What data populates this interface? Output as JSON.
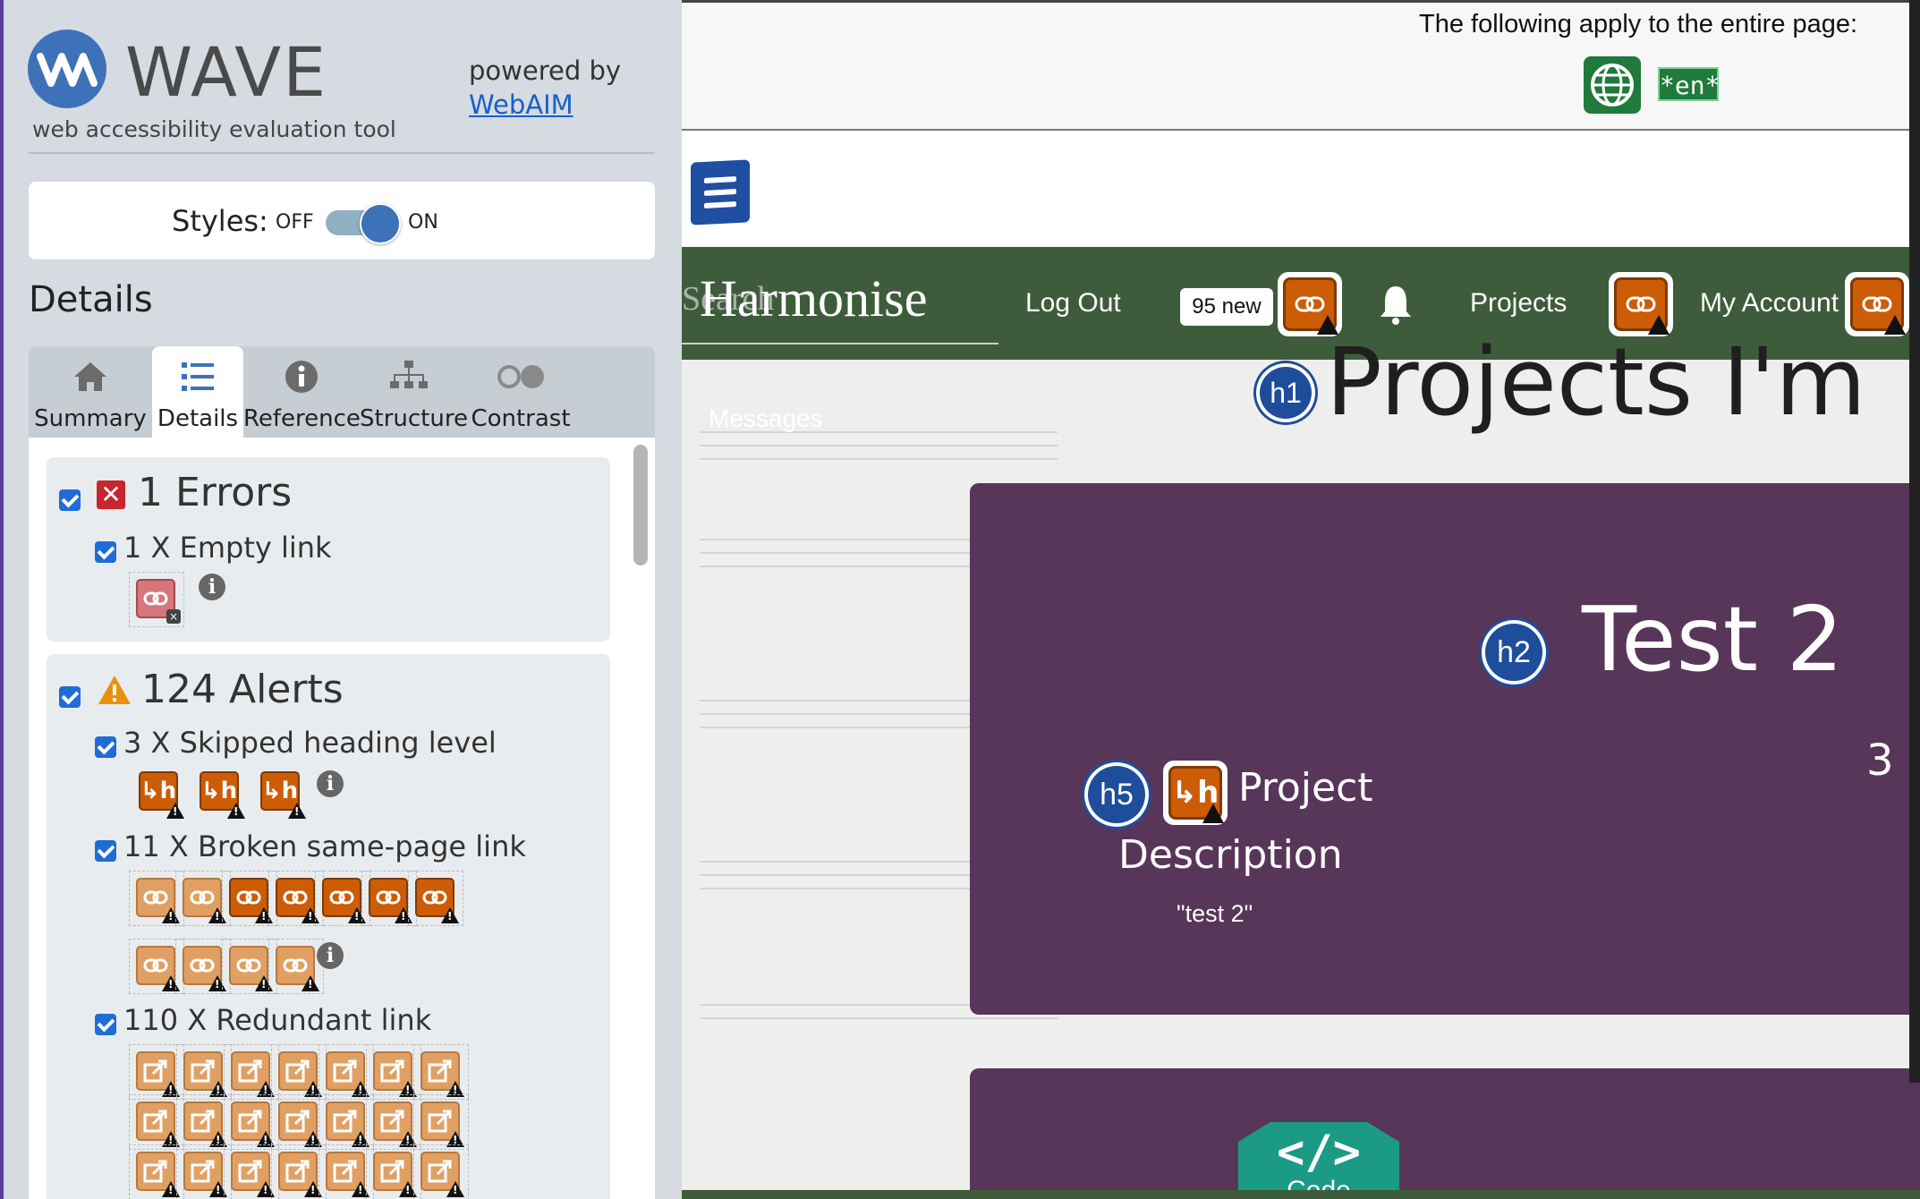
{
  "wave": {
    "title": "WAVE",
    "tagline": "web accessibility evaluation tool",
    "powered_by": "powered by",
    "webaim_link": "WebAIM",
    "styles_label": "Styles:",
    "styles_off": "OFF",
    "styles_on": "ON",
    "styles_enabled": true,
    "details_heading": "Details",
    "tabs": [
      {
        "label": "Summary",
        "icon": "home-icon",
        "active": false
      },
      {
        "label": "Details",
        "icon": "list-icon",
        "active": true
      },
      {
        "label": "Reference",
        "icon": "info-icon",
        "active": false
      },
      {
        "label": "Structure",
        "icon": "hierarchy-icon",
        "active": false
      },
      {
        "label": "Contrast",
        "icon": "contrast-icon",
        "active": false
      }
    ],
    "errors": {
      "title": "1 Errors",
      "items": [
        {
          "label": "1 X Empty link",
          "icon": "empty-link-icon"
        }
      ]
    },
    "alerts": {
      "title": "124 Alerts",
      "items": [
        {
          "label": "3 X Skipped heading level",
          "icon": "skipped-heading-icon"
        },
        {
          "label": "11 X Broken same-page link",
          "icon": "broken-link-icon"
        },
        {
          "label": "110 X Redundant link",
          "icon": "redundant-link-icon"
        }
      ]
    }
  },
  "page": {
    "apply_text": "The following apply to the entire page:",
    "language_badge": "*en*",
    "brand": "Harmonise",
    "search_ghost": "Search",
    "nav": {
      "logout": "Log Out",
      "new_badge": "95 new",
      "projects": "Projects",
      "my_account": "My Account"
    },
    "messages_ghost": "Messages",
    "h1_badge": "h1",
    "h1_text": "Projects I'm",
    "card": {
      "h2_badge": "h2",
      "title": "Test 2",
      "h5_badge": "h5",
      "subheading_line1": "Project",
      "subheading_line2": "Description",
      "description": "\"test 2\"",
      "count": "3"
    },
    "code_button": {
      "symbol": "</>",
      "label": "Code"
    }
  },
  "colors": {
    "wave_blue": "#3d72b8",
    "nav_green": "#3e5c3b",
    "card_purple": "#573659",
    "alert_orange": "#cc5c06",
    "error_red": "#c6262c",
    "code_teal": "#1b9a86"
  }
}
